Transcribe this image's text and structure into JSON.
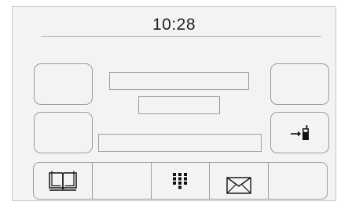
{
  "status_bar": {
    "clock": "10:28"
  },
  "side_buttons": {
    "top_left": "",
    "bottom_left": "",
    "top_right": "",
    "bottom_right_icon": "transfer-to-phone-icon"
  },
  "info_fields": [
    "",
    "",
    ""
  ],
  "bottom_bar": {
    "items": [
      {
        "icon": "book-icon"
      },
      {
        "icon": ""
      },
      {
        "icon": "keypad-icon"
      },
      {
        "icon": "envelope-icon"
      },
      {
        "icon": ""
      }
    ]
  },
  "colors": {
    "screen_background": "#f3f3f3",
    "outline": "#9c9c9c",
    "divider": "#b9b9b9",
    "text": "#222222"
  }
}
